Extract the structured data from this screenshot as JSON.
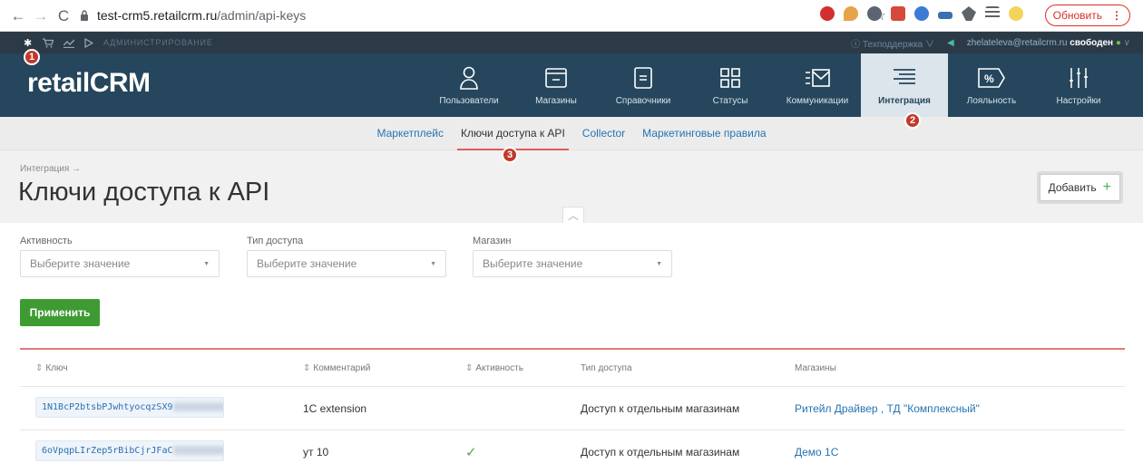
{
  "browser": {
    "host": "test-crm5.retailcrm.ru",
    "path": "/admin/api-keys",
    "reload_label": "Обновить"
  },
  "adminbar": {
    "title": "АДМИНИСТРИРОВАНИЕ",
    "support": "Техподдержка",
    "email": "zhelateleva@retailcrm.ru",
    "status": "свободен"
  },
  "logo": "retailCRM",
  "nav": {
    "items": [
      {
        "label": "Пользователи",
        "icon": "user-icon"
      },
      {
        "label": "Магазины",
        "icon": "store-icon"
      },
      {
        "label": "Справочники",
        "icon": "directory-icon"
      },
      {
        "label": "Статусы",
        "icon": "status-grid-icon"
      },
      {
        "label": "Коммуникации",
        "icon": "mail-icon"
      },
      {
        "label": "Интеграция",
        "icon": "integration-icon"
      },
      {
        "label": "Лояльность",
        "icon": "percent-tag-icon"
      },
      {
        "label": "Настройки",
        "icon": "sliders-icon"
      }
    ],
    "active": "Интеграция"
  },
  "subnav": {
    "items": [
      "Маркетплейс",
      "Ключи доступа к API",
      "Collector",
      "Маркетинговые правила"
    ],
    "active": "Ключи доступа к API"
  },
  "badges": [
    "1",
    "2",
    "3"
  ],
  "header": {
    "breadcrumb": "Интеграция →",
    "title": "Ключи доступа к API",
    "add_label": "Добавить"
  },
  "filters": {
    "activity_label": "Активность",
    "access_label": "Тип доступа",
    "shop_label": "Магазин",
    "placeholder": "Выберите значение",
    "apply_label": "Применить"
  },
  "table": {
    "columns": [
      "Ключ",
      "Комментарий",
      "Активность",
      "Тип доступа",
      "Магазины"
    ],
    "rows": [
      {
        "key": "1N1BcP2btsbPJwhtyocqzSX9",
        "comment": "1C extension",
        "active": false,
        "access": "Доступ к отдельным магазинам",
        "shops": "Ритейл Драйвер , ТД \"Комплексный\""
      },
      {
        "key": "6oVpqpLIrZep5rBibCjrJFaC",
        "comment": "ут 10",
        "active": true,
        "access": "Доступ к отдельным магазинам",
        "shops": "Демо 1С"
      }
    ]
  },
  "colors": {
    "nav_bg": "#25465c",
    "accent_green": "#3d9b32",
    "badge_red": "#c0392b",
    "link": "#2474b2"
  }
}
